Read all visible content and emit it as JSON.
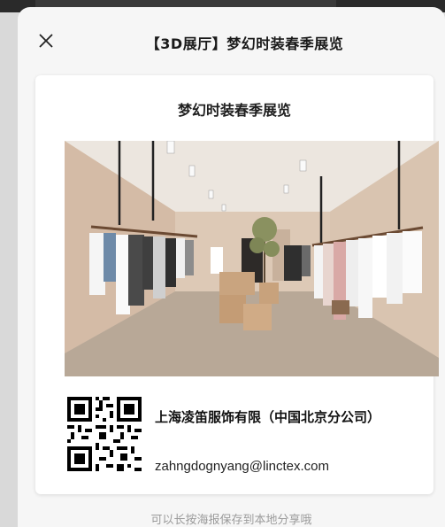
{
  "sheet": {
    "title": "【3D展厅】梦幻时装春季展览",
    "close_icon": "close-icon"
  },
  "poster": {
    "title": "梦幻时装春季展览",
    "photo_description_icon": "showroom-photo",
    "company_name": "上海凌笛服饰有限（中国北京分公司）",
    "email": "zahngdognyang@linctex.com",
    "qr_icon": "qr-code-icon"
  },
  "footer": {
    "hint": "可以长按海报保存到本地分享哦"
  },
  "colors": {
    "sheet_bg": "#f6f6f6",
    "card_bg": "#ffffff",
    "hint_text": "#9b9b9b",
    "wall": "#d9c5b2",
    "floor": "#b9aa99"
  }
}
